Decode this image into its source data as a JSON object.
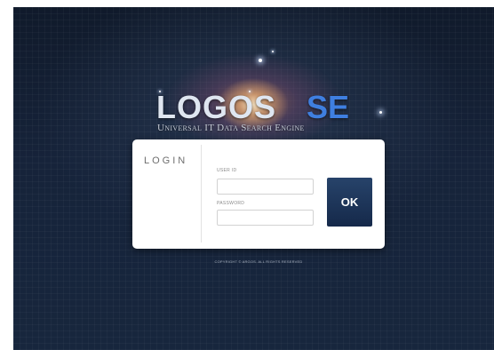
{
  "logo": {
    "main_text": "LOGOS",
    "suffix_text": "SE",
    "tagline": "Universal IT Data Search Engine"
  },
  "login": {
    "title": "LOGIN",
    "user_id_label": "USER ID",
    "user_id_value": "",
    "password_label": "PASSWORD",
    "password_value": "",
    "ok_label": "OK"
  },
  "footer": {
    "copyright": "COPYRIGHT © ARGOS. ALL RIGHTS RESERVED"
  },
  "colors": {
    "background": "#16233a",
    "logo_accent": "#3f7fe0",
    "ok_button": "#1d3457"
  }
}
